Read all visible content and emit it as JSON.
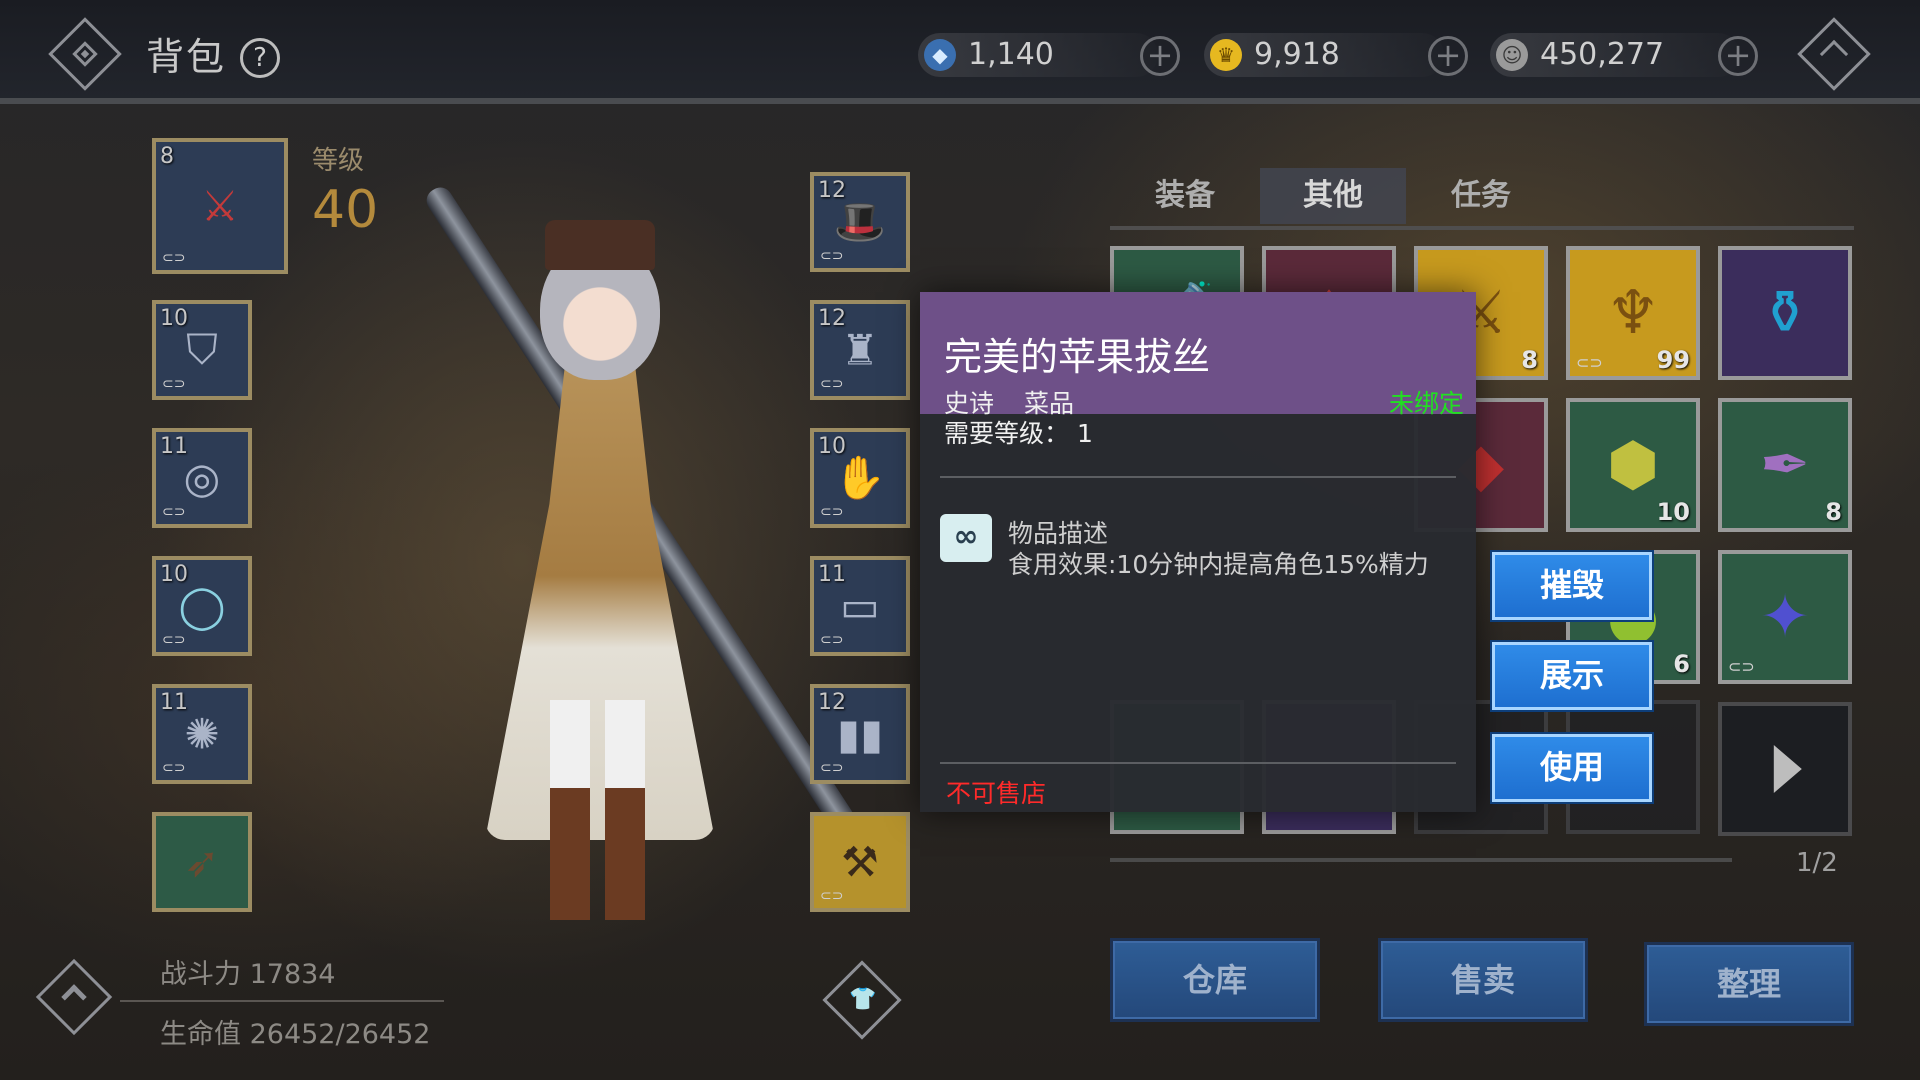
{
  "header": {
    "title": "背包",
    "help": "?",
    "currencies": [
      {
        "name": "diamond",
        "icon": "diamond-icon",
        "value": "1,140"
      },
      {
        "name": "gold",
        "icon": "crown-coin-icon",
        "value": "9,918"
      },
      {
        "name": "silver",
        "icon": "silver-coin-icon",
        "value": "450,277"
      }
    ]
  },
  "character": {
    "level_label": "等级",
    "level": "40",
    "power": "战斗力 17834",
    "hp": "生命值 26452/26452"
  },
  "equipment": {
    "left": [
      {
        "level": "8",
        "icon": "sword-icon"
      },
      {
        "level": "10",
        "icon": "amulet-icon"
      },
      {
        "level": "11",
        "icon": "bracer-icon"
      },
      {
        "level": "10",
        "icon": "ring-icon"
      },
      {
        "level": "11",
        "icon": "emblem-icon"
      },
      {
        "level": "",
        "icon": "horn-icon"
      }
    ],
    "right": [
      {
        "level": "12",
        "icon": "top-hat-icon"
      },
      {
        "level": "12",
        "icon": "armor-icon"
      },
      {
        "level": "10",
        "icon": "gloves-icon"
      },
      {
        "level": "11",
        "icon": "belt-icon"
      },
      {
        "level": "12",
        "icon": "boots-icon"
      },
      {
        "level": "",
        "icon": "axe-icon"
      }
    ]
  },
  "tabs": [
    {
      "label": "装备",
      "active": false
    },
    {
      "label": "其他",
      "active": true
    },
    {
      "label": "任务",
      "active": false
    }
  ],
  "inventory": {
    "row1": [
      {
        "icon": "potion-icon",
        "qty": ""
      },
      {
        "icon": "ruby-crest-icon",
        "qty": ""
      },
      {
        "icon": "sword-medal-icon",
        "qty": "8"
      },
      {
        "icon": "trident-medal-icon",
        "qty": "99"
      },
      {
        "icon": "blue-potion-icon",
        "qty": ""
      }
    ],
    "row2": [
      {
        "icon": "ruby-ore-icon",
        "qty": ""
      },
      {
        "icon": "gold-ore-icon",
        "qty": "10"
      },
      {
        "icon": "feather-icon",
        "qty": "8"
      }
    ],
    "row3": [
      {
        "icon": "green-orb-icon",
        "qty": "6"
      },
      {
        "icon": "crystal-icon",
        "qty": ""
      }
    ],
    "page": "1/2"
  },
  "bottom_buttons": [
    "仓库",
    "售卖",
    "整理"
  ],
  "tooltip": {
    "name": "完美的苹果拔丝",
    "rarity": "史诗",
    "type": "菜品",
    "bind_status": "未绑定",
    "required_level": "需要等级：  1",
    "desc_title": "物品描述",
    "desc": "食用效果:10分钟内提高角色15%精力",
    "sell_note": "不可售店",
    "link_icon": "chain-link-icon"
  },
  "actions": [
    "摧毁",
    "展示",
    "使用"
  ],
  "colors": {
    "tooltip_header": "#6e5088",
    "unbound_green": "#21e021",
    "no_sell_red": "#ff2a2a",
    "action_blue": "#1e6fd0"
  }
}
